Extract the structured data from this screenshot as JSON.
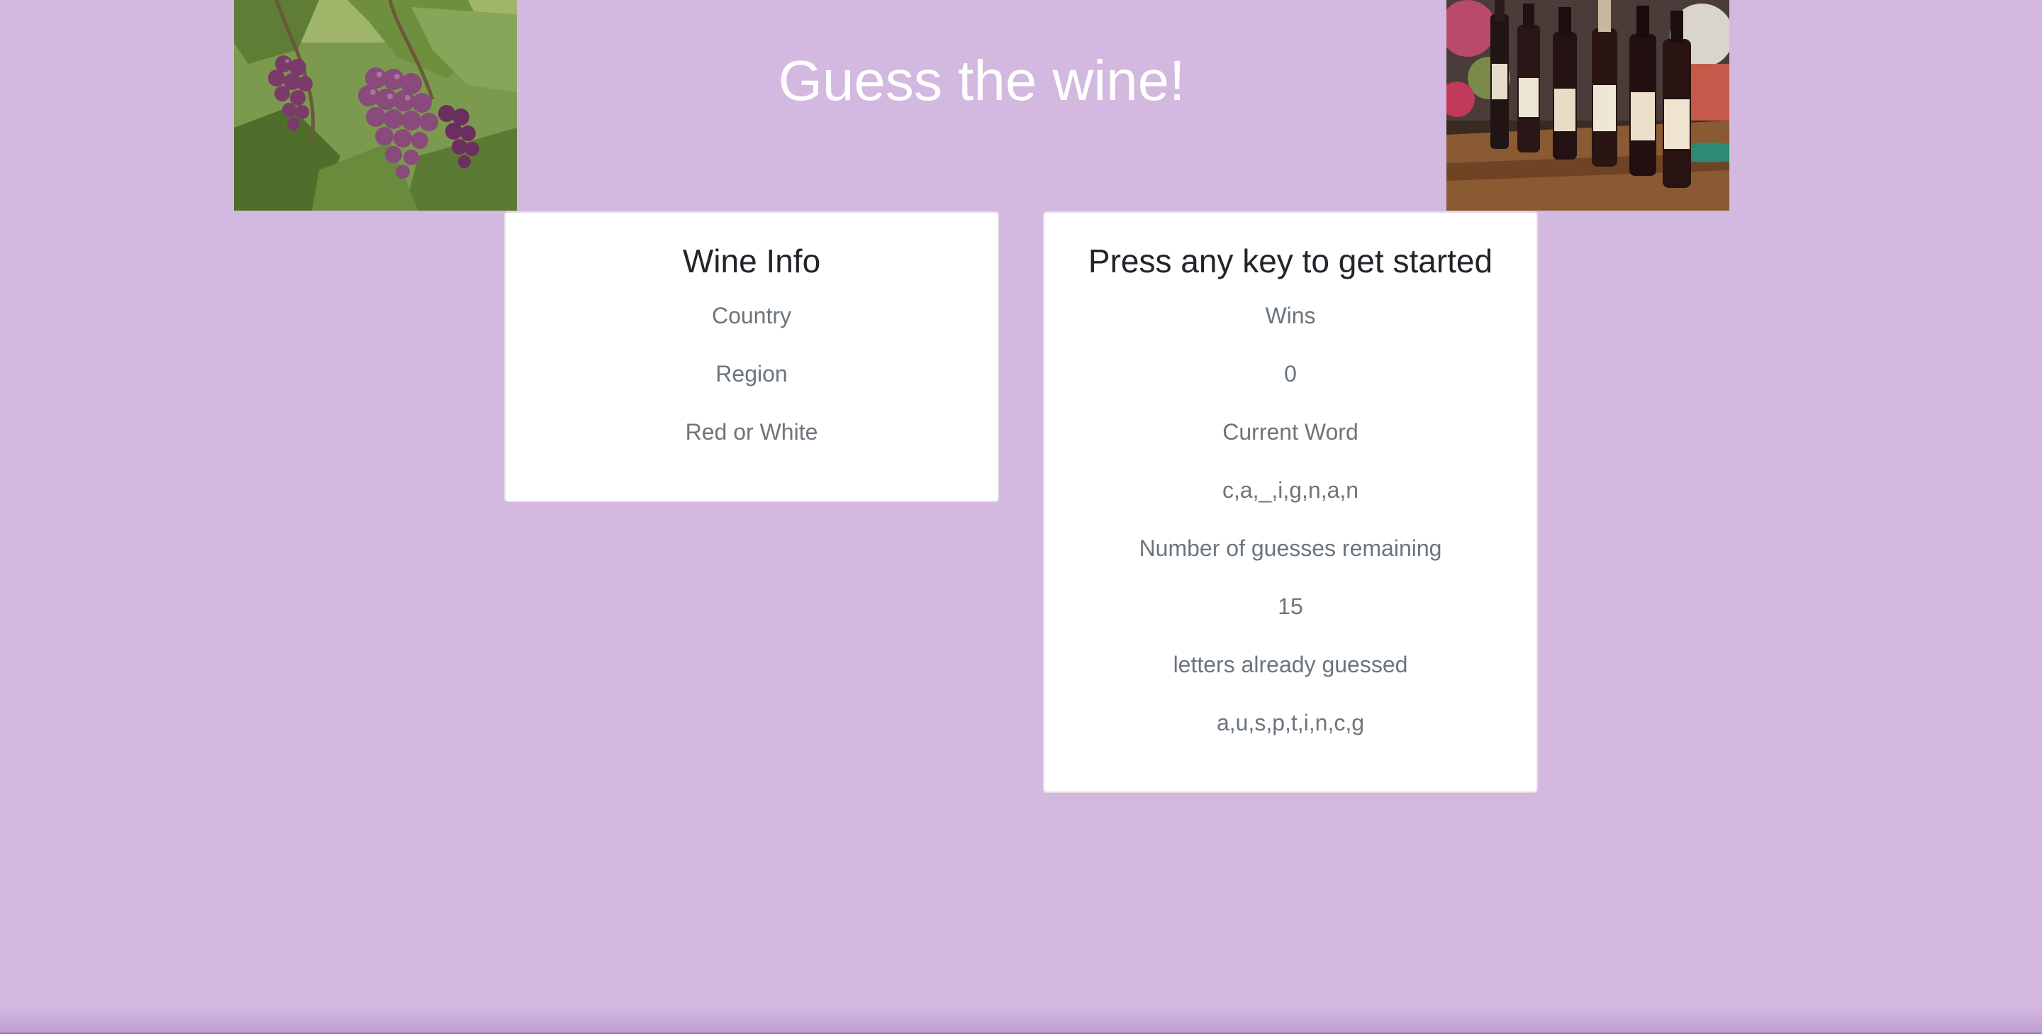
{
  "header": {
    "title": "Guess the wine!",
    "left_image": "grapes-photo",
    "right_image": "wine-bottles-photo"
  },
  "wine_info": {
    "title": "Wine Info",
    "country_label": "Country",
    "region_label": "Region",
    "color_label": "Red or White"
  },
  "game": {
    "title": "Press any key to get started",
    "wins_label": "Wins",
    "wins_value": "0",
    "current_word_label": "Current Word",
    "current_word_value": "c,a,_,i,g,n,a,n",
    "guesses_label": "Number of guesses remaining",
    "guesses_value": "15",
    "letters_label": "letters already guessed",
    "letters_value": "a,u,s,p,t,i,n,c,g"
  },
  "colors": {
    "background": "#d3b8e0",
    "card": "#ffffff",
    "heading_text": "#212529",
    "muted_text": "#6c757d",
    "title_text": "#ffffff"
  }
}
